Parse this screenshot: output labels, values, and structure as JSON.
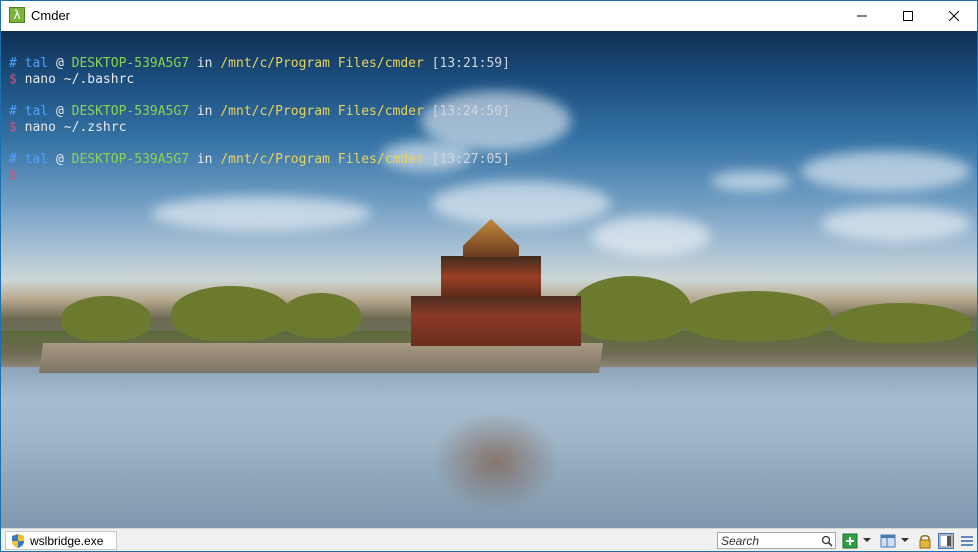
{
  "window": {
    "title": "Cmder"
  },
  "terminal": {
    "prompts": [
      {
        "user": "tal",
        "host": "DESKTOP-539A5G7",
        "path": "/mnt/c/Program Files/cmder",
        "time": "[13:21:59]",
        "command": "nano ~/.bashrc"
      },
      {
        "user": "tal",
        "host": "DESKTOP-539A5G7",
        "path": "/mnt/c/Program Files/cmder",
        "time": "[13:24:50]",
        "command": "nano ~/.zshrc"
      },
      {
        "user": "tal",
        "host": "DESKTOP-539A5G7",
        "path": "/mnt/c/Program Files/cmder",
        "time": "[13:27:05]",
        "command": ""
      }
    ],
    "symbols": {
      "hash": "#",
      "at": "@",
      "in": "in",
      "dollar": "$"
    }
  },
  "statusbar": {
    "tab_label": "wslbridge.exe",
    "search_placeholder": "Search"
  },
  "icons": {
    "app": "lambda-icon",
    "tab": "shield-icon",
    "search": "search-icon",
    "new_console": "plus-icon",
    "menu_dropdown": "chevron-down-icon",
    "split": "window-icon",
    "lock": "lock-icon",
    "layout": "panel-icon",
    "menu": "hamburger-icon"
  },
  "colors": {
    "accent_green": "#7bb33b",
    "host": "#8fd14f",
    "user": "#4fa3ff",
    "path": "#e9d35c",
    "dollar": "#e14c6b"
  }
}
